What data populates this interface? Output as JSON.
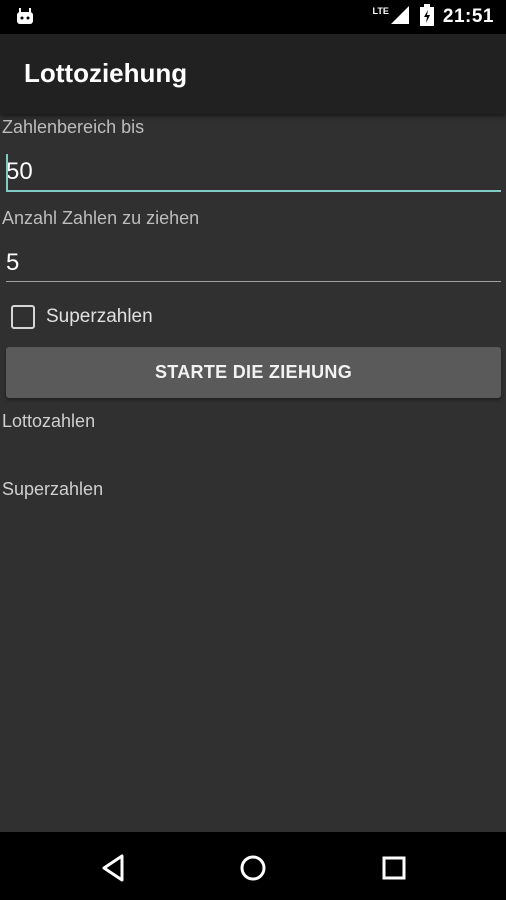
{
  "status_bar": {
    "time": "21:51",
    "network": "LTE",
    "icons": [
      "android-notification-icon",
      "signal-icon",
      "battery-icon"
    ]
  },
  "app": {
    "title": "Lottoziehung"
  },
  "form": {
    "range_label": "Zahlenbereich bis",
    "range_value": "50",
    "count_label": "Anzahl Zahlen zu ziehen",
    "count_value": "5",
    "superzahlen_checkbox_label": "Superzahlen",
    "superzahlen_checked": false,
    "start_button_label": "STARTE DIE ZIEHUNG"
  },
  "results": {
    "lotto_label": "Lottozahlen",
    "super_label": "Superzahlen"
  },
  "nav": {
    "icons": [
      "back-icon",
      "home-icon",
      "recents-icon"
    ]
  },
  "colors": {
    "background": "#303030",
    "app_bar": "#212121",
    "accent": "#80cbc4",
    "button": "#5a5a5a"
  }
}
